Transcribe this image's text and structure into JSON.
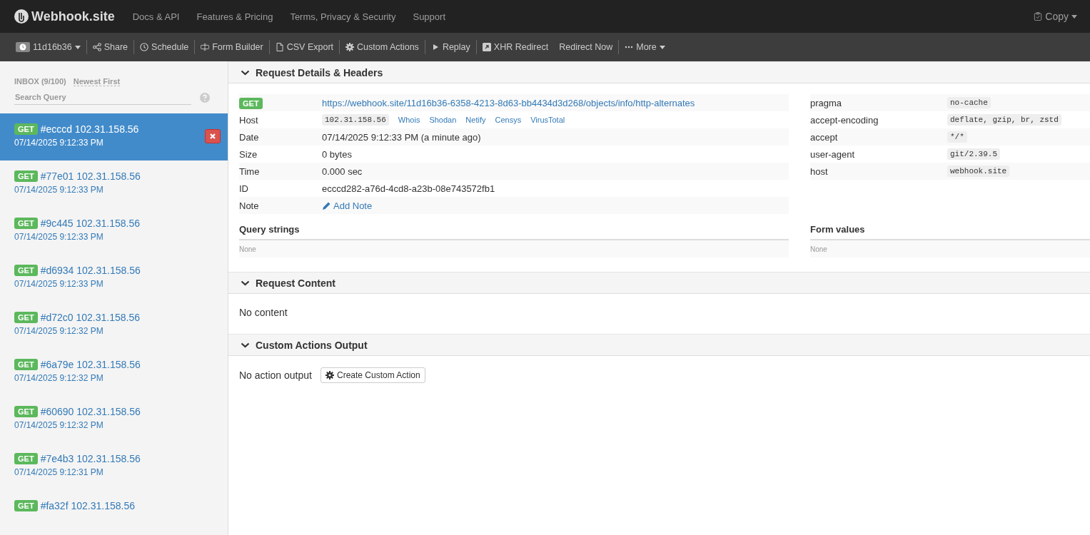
{
  "navbar": {
    "brand": "Webhook.site",
    "links": [
      "Docs & API",
      "Features & Pricing",
      "Terms, Privacy & Security",
      "Support"
    ],
    "copy": "Copy"
  },
  "toolbar": {
    "groups": [
      [
        {
          "kind": "token",
          "label": "11d16b36"
        }
      ],
      [
        {
          "kind": "share",
          "label": "Share"
        }
      ],
      [
        {
          "kind": "schedule",
          "label": "Schedule"
        }
      ],
      [
        {
          "kind": "form",
          "label": "Form Builder"
        }
      ],
      [
        {
          "kind": "file",
          "label": "CSV Export"
        }
      ],
      [
        {
          "kind": "gear",
          "label": "Custom Actions"
        }
      ],
      [
        {
          "kind": "play",
          "label": "Replay"
        }
      ],
      [
        {
          "kind": "external",
          "label": "XHR Redirect"
        },
        {
          "kind": "plain",
          "label": "Redirect Now"
        }
      ],
      [
        {
          "kind": "more",
          "label": "More"
        }
      ]
    ]
  },
  "sidebar": {
    "inbox": "INBOX (9/100)",
    "sort": "Newest First",
    "search": {
      "placeholder": "Search Query"
    },
    "requests": [
      {
        "method": "GET",
        "title": "#ecccd 102.31.158.56",
        "time": "07/14/2025 9:12:33 PM",
        "selected": true
      },
      {
        "method": "GET",
        "title": "#77e01 102.31.158.56",
        "time": "07/14/2025 9:12:33 PM",
        "selected": false
      },
      {
        "method": "GET",
        "title": "#9c445 102.31.158.56",
        "time": "07/14/2025 9:12:33 PM",
        "selected": false
      },
      {
        "method": "GET",
        "title": "#d6934 102.31.158.56",
        "time": "07/14/2025 9:12:33 PM",
        "selected": false
      },
      {
        "method": "GET",
        "title": "#d72c0 102.31.158.56",
        "time": "07/14/2025 9:12:32 PM",
        "selected": false
      },
      {
        "method": "GET",
        "title": "#6a79e 102.31.158.56",
        "time": "07/14/2025 9:12:32 PM",
        "selected": false
      },
      {
        "method": "GET",
        "title": "#60690 102.31.158.56",
        "time": "07/14/2025 9:12:32 PM",
        "selected": false
      },
      {
        "method": "GET",
        "title": "#7e4b3 102.31.158.56",
        "time": "07/14/2025 9:12:31 PM",
        "selected": false
      },
      {
        "method": "GET",
        "title": "#fa32f 102.31.158.56",
        "selected": false
      }
    ]
  },
  "details": {
    "title": "Request Details & Headers",
    "method": "GET",
    "url": "https://webhook.site/11d16b36-6358-4213-8d63-bb4434d3d268/objects/info/http-alternates",
    "rows": [
      {
        "kind": "host",
        "label": "Host",
        "value": "102.31.158.56",
        "links": [
          "Whois",
          "Shodan",
          "Netify",
          "Censys",
          "VirusTotal"
        ]
      },
      {
        "kind": "text",
        "label": "Date",
        "value": "07/14/2025 9:12:33 PM (a minute ago)"
      },
      {
        "kind": "text",
        "label": "Size",
        "value": "0 bytes"
      },
      {
        "kind": "text",
        "label": "Time",
        "value": "0.000 sec"
      },
      {
        "kind": "text",
        "label": "ID",
        "value": "ecccd282-a76d-4cd8-a23b-08e743572fb1"
      },
      {
        "kind": "note",
        "label": "Note",
        "value": "Add Note"
      }
    ],
    "headers": [
      {
        "name": "pragma",
        "value": "no-cache"
      },
      {
        "name": "accept-encoding",
        "value": "deflate, gzip, br, zstd"
      },
      {
        "name": "accept",
        "value": "*/*"
      },
      {
        "name": "user-agent",
        "value": "git/2.39.5"
      },
      {
        "name": "host",
        "value": "webhook.site"
      }
    ],
    "query_strings": {
      "title": "Query strings",
      "value": "None"
    },
    "form_values": {
      "title": "Form values",
      "value": "None"
    }
  },
  "content": {
    "title": "Request Content",
    "text": "No content"
  },
  "actions": {
    "title": "Custom Actions Output",
    "text": "No action output",
    "button": "Create Custom Action"
  }
}
